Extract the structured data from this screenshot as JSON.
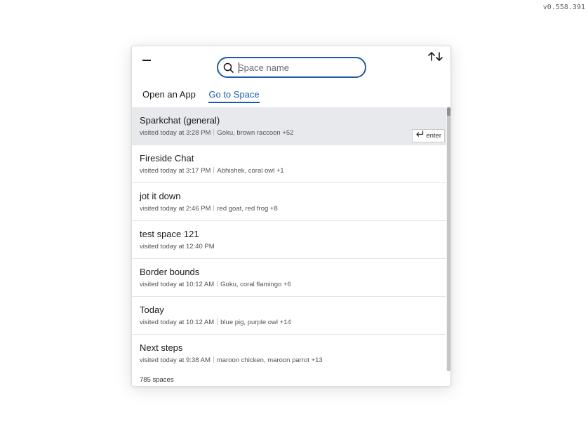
{
  "version": "v0.558.391",
  "search": {
    "placeholder": "Space name",
    "value": ""
  },
  "tabs": [
    {
      "label": "Open an App",
      "active": false
    },
    {
      "label": "Go to Space",
      "active": true
    }
  ],
  "enter_label": "enter",
  "spaces": [
    {
      "name": "Sparkchat (general)",
      "visited": "visited today at 3:28 PM",
      "members": "Goku, brown raccoon +52",
      "selected": true
    },
    {
      "name": "Fireside Chat",
      "visited": "visited today at 3:17 PM",
      "members": "Abhishek, coral owl +1"
    },
    {
      "name": "jot it down",
      "visited": "visited today at 2:46 PM",
      "members": "red goat, red frog +8"
    },
    {
      "name": "test space 121",
      "visited": "visited today at 12:40 PM",
      "members": ""
    },
    {
      "name": "Border bounds",
      "visited": "visited today at 10:12 AM",
      "members": "Goku, coral flamingo +6"
    },
    {
      "name": "Today",
      "visited": "visited today at 10:12 AM",
      "members": "blue pig, purple owl +14"
    },
    {
      "name": "Next steps",
      "visited": "visited today at 9:38 AM",
      "members": "maroon chicken, maroon parrot +13"
    }
  ],
  "footer": {
    "count_label": "785 spaces"
  },
  "colors": {
    "accent": "#1f5aa8",
    "selected_row": "#e7e9ec"
  },
  "icons": {
    "minimize": "minimize-icon",
    "sort": "sort-arrows-icon",
    "search": "search-icon",
    "enter": "enter-return-icon"
  }
}
